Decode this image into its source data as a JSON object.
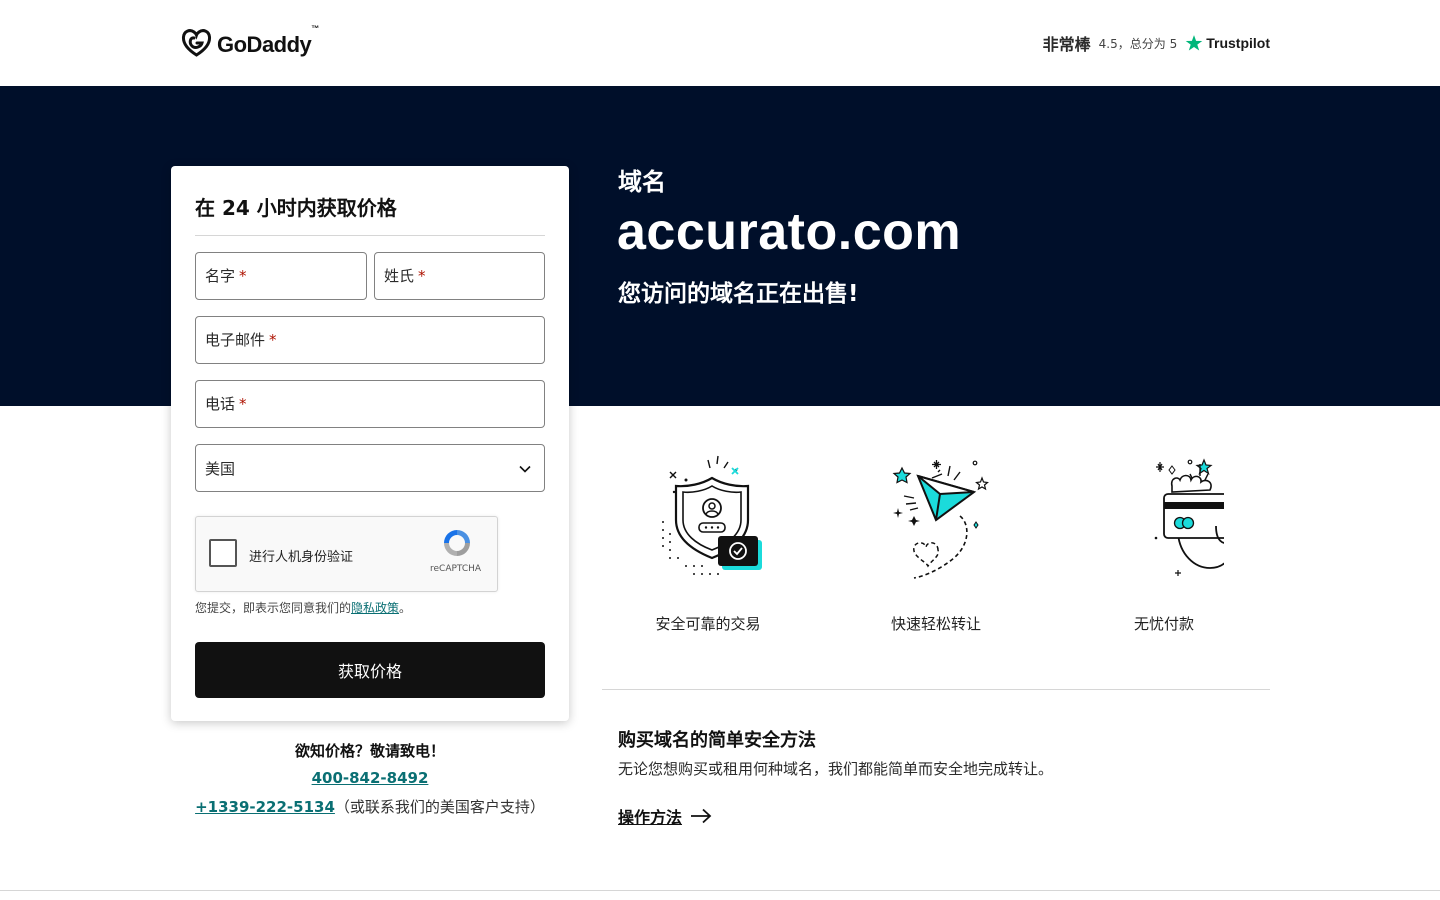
{
  "header": {
    "logo_text": "GoDaddy",
    "logo_tm": "™",
    "rating_word": "非常棒",
    "rating_score": "4.5，总分为 5",
    "trustpilot": "Trustpilot"
  },
  "hero": {
    "label": "域名",
    "domain": "accurato.com",
    "subtitle": "您访问的域名正在出售!"
  },
  "form": {
    "title": "在 24 小时内获取价格",
    "first_name_label": "名字",
    "last_name_label": "姓氏",
    "email_label": "电子邮件",
    "phone_label": "电话",
    "required_mark": "*",
    "country_value": "美国",
    "captcha_text": "进行人机身份验证",
    "captcha_brand": "reCAPTCHA",
    "consent_text": "您提交，即表示您同意我们的",
    "consent_link": "隐私政策",
    "consent_end": "。",
    "submit_label": "获取价格"
  },
  "contact": {
    "question": "欲知价格？敬请致电！",
    "phone_cn": "400-842-8492",
    "phone_us": "+1339-222-5134",
    "phone_us_note": "（或联系我们的美国客户支持）"
  },
  "features": [
    {
      "label": "安全可靠的交易",
      "icon": "shield-icon"
    },
    {
      "label": "快速轻松转让",
      "icon": "paper-plane-icon"
    },
    {
      "label": "无忧付款",
      "icon": "card-in-hand-icon"
    }
  ],
  "how": {
    "title": "购买域名的简单安全方法",
    "description": "无论您想购买或租用何种域名，我们都能简单而安全地完成转让。",
    "link_label": "操作方法"
  },
  "colors": {
    "hero_bg": "#000f2a",
    "accent_teal": "#1bdbdb",
    "link_teal": "#0a6f73",
    "required_red": "#ae1302",
    "button_bg": "#111111",
    "trustpilot_green": "#00b67a"
  }
}
